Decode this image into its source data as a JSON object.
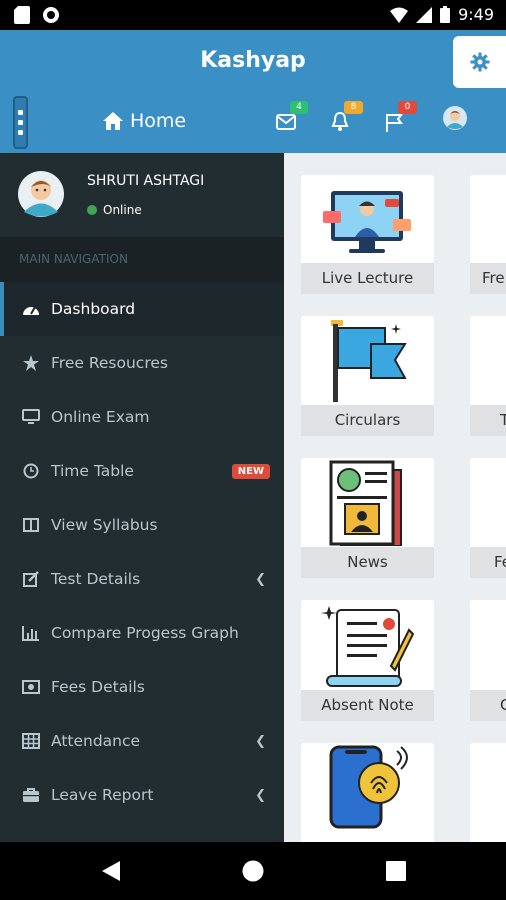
{
  "status_bar": {
    "time": "9:49"
  },
  "app_bar": {
    "title": "Kashyap"
  },
  "nav_bar": {
    "home_label": "Home",
    "badges": {
      "messages": "4",
      "notifications": "8",
      "flags": "0"
    },
    "colors": {
      "messages": "#2fbf71",
      "notifications": "#f0a92e",
      "flags": "#e04a3a"
    }
  },
  "sidebar": {
    "user_name": "SHRUTI ASHTAGI",
    "user_status": "Online",
    "section_title": "MAIN NAVIGATION",
    "items": [
      {
        "label": "Dashboard",
        "icon": "dashboard-icon"
      },
      {
        "label": "Free Resoucres",
        "icon": "star-icon"
      },
      {
        "label": "Online Exam",
        "icon": "monitor-icon"
      },
      {
        "label": "Time Table",
        "icon": "clock-icon",
        "tag": "NEW"
      },
      {
        "label": "View Syllabus",
        "icon": "book-icon"
      },
      {
        "label": "Test Details",
        "icon": "edit-icon"
      },
      {
        "label": "Compare Progess Graph",
        "icon": "bar-chart-icon"
      },
      {
        "label": "Fees Details",
        "icon": "money-icon"
      },
      {
        "label": "Attendance",
        "icon": "table-icon"
      },
      {
        "label": "Leave Report",
        "icon": "briefcase-icon"
      }
    ]
  },
  "content": {
    "cards": [
      {
        "label": "Live Lecture",
        "icon": "live-lecture-icon"
      },
      {
        "label": "Circulars",
        "icon": "flag-icon"
      },
      {
        "label": "News",
        "icon": "newspaper-icon"
      },
      {
        "label": "Absent Note",
        "icon": "note-icon"
      },
      {
        "label": "",
        "icon": "fingerprint-phone-icon"
      }
    ],
    "partial_cards": [
      {
        "label": "Fre"
      },
      {
        "label": "T"
      },
      {
        "label": "Fe"
      },
      {
        "label": "C"
      }
    ]
  },
  "accent_color": "#3a8fc4"
}
